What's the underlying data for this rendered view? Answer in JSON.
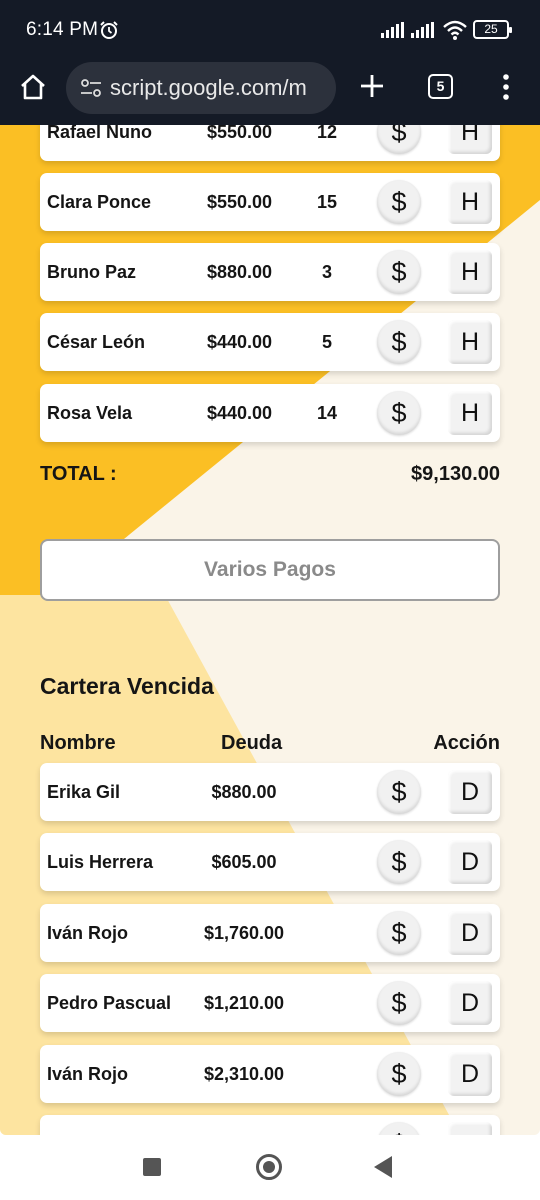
{
  "status_bar": {
    "time": "6:14 PM",
    "battery": "25"
  },
  "browser": {
    "url": "script.google.com/m",
    "tab_count": "5"
  },
  "upper_list": {
    "rows": [
      {
        "name": "Rafael Nuno",
        "amount": "$550.00",
        "count": "12",
        "pay_label": "$",
        "hist_label": "H"
      },
      {
        "name": "Clara Ponce",
        "amount": "$550.00",
        "count": "15",
        "pay_label": "$",
        "hist_label": "H"
      },
      {
        "name": "Bruno Paz",
        "amount": "$880.00",
        "count": "3",
        "pay_label": "$",
        "hist_label": "H"
      },
      {
        "name": "César León",
        "amount": "$440.00",
        "count": "5",
        "pay_label": "$",
        "hist_label": "H"
      },
      {
        "name": "Rosa Vela",
        "amount": "$440.00",
        "count": "14",
        "pay_label": "$",
        "hist_label": "H"
      }
    ],
    "total_label": "TOTAL :",
    "total_value": "$9,130.00",
    "multi_pay_label": "Varios Pagos"
  },
  "overdue": {
    "title": "Cartera Vencida",
    "headers": {
      "name": "Nombre",
      "debt": "Deuda",
      "action": "Acción"
    },
    "rows": [
      {
        "name": "Erika Gil",
        "debt": "$880.00",
        "pay_label": "$",
        "action_label": "D"
      },
      {
        "name": "Luis Herrera",
        "debt": "$605.00",
        "pay_label": "$",
        "action_label": "D"
      },
      {
        "name": "Iván Rojo",
        "debt": "$1,760.00",
        "pay_label": "$",
        "action_label": "D"
      },
      {
        "name": "Pedro Pascual",
        "debt": "$1,210.00",
        "pay_label": "$",
        "action_label": "D"
      },
      {
        "name": "Iván Rojo",
        "debt": "$2,310.00",
        "pay_label": "$",
        "action_label": "D"
      },
      {
        "name": "",
        "debt": "",
        "pay_label": "$",
        "action_label": ""
      }
    ]
  },
  "colors": {
    "accent_dark": "#fbbf24",
    "accent_light": "#fde4a0",
    "background": "#faf4e8",
    "chrome": "#141a26"
  }
}
